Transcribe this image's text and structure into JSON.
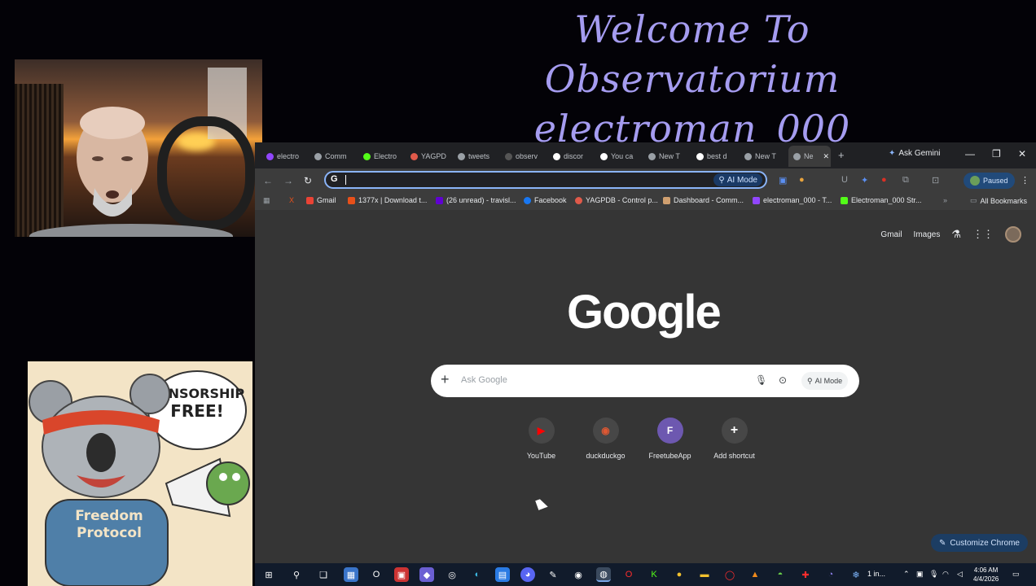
{
  "overlay": {
    "line1": "Welcome To Observatorium",
    "line2": "electroman_000"
  },
  "sticker": {
    "speech": "CENSORSHIP FREE!",
    "hoodie_line1": "Freedom",
    "hoodie_line2": "Protocol"
  },
  "browser": {
    "tabs": [
      {
        "label": "electro",
        "icon": "twitch-icon",
        "color": "#9146ff"
      },
      {
        "label": "Comm",
        "icon": "globe-icon",
        "color": "#9aa0a6"
      },
      {
        "label": "Electro",
        "icon": "kick-icon",
        "color": "#53fc18"
      },
      {
        "label": "YAGPD",
        "icon": "yagpdb-icon",
        "color": "#e05a4a"
      },
      {
        "label": "tweets",
        "icon": "globe-icon",
        "color": "#9aa0a6"
      },
      {
        "label": "observ",
        "icon": "github-icon",
        "color": "#202020"
      },
      {
        "label": "discor",
        "icon": "google-icon",
        "color": "#ffffff"
      },
      {
        "label": "You ca",
        "icon": "google-icon",
        "color": "#ffffff"
      },
      {
        "label": "New T",
        "icon": "chrome-icon",
        "color": "#9aa0a6"
      },
      {
        "label": "best d",
        "icon": "google-icon",
        "color": "#ffffff"
      },
      {
        "label": "New T",
        "icon": "chrome-icon",
        "color": "#9aa0a6"
      },
      {
        "label": "Ne",
        "icon": "chrome-icon",
        "color": "#9aa0a6"
      }
    ],
    "new_tab": "+",
    "ask_gemini": "Ask Gemini",
    "omnibox_value": "",
    "ai_mode_label": "AI Mode",
    "profile_status": "Paused",
    "bookmarks": [
      {
        "label": "Gmail",
        "color": "#ea4335"
      },
      {
        "label": "1377x | Download t...",
        "color": "#e8501a"
      },
      {
        "label": "(26 unread) - travisl...",
        "color": "#6001d2"
      },
      {
        "label": "Facebook",
        "color": "#1877f2"
      },
      {
        "label": "YAGPDB - Control p...",
        "color": "#e05a4a"
      },
      {
        "label": "Dashboard - Comm...",
        "color": "#d0a070"
      },
      {
        "label": "electroman_000 - T...",
        "color": "#9146ff"
      },
      {
        "label": "Electroman_000 Str...",
        "color": "#53fc18"
      }
    ],
    "all_bookmarks": "All Bookmarks",
    "bookmark_x": "X"
  },
  "newtab": {
    "gmail": "Gmail",
    "images": "Images",
    "logo": "Google",
    "search_placeholder": "Ask Google",
    "ai_mode": "AI Mode",
    "shortcuts": [
      {
        "label": "YouTube",
        "glyph": "▶",
        "color": "#ff0000"
      },
      {
        "label": "duckduckgo",
        "glyph": "◉",
        "color": "#de5833"
      },
      {
        "label": "FreetubeApp",
        "glyph": "F",
        "color": "#8b6ad8"
      },
      {
        "label": "Add shortcut",
        "glyph": "+",
        "color": "#ffffff"
      }
    ],
    "customize": "Customize Chrome"
  },
  "taskbar": {
    "tray_label": "1 in...",
    "time": "4:06 AM",
    "date": "4/4/2026"
  },
  "colors": {
    "overlay_text": "#a59cf0",
    "chrome_dark": "#202124",
    "accent_blue": "#8ab4f8"
  }
}
